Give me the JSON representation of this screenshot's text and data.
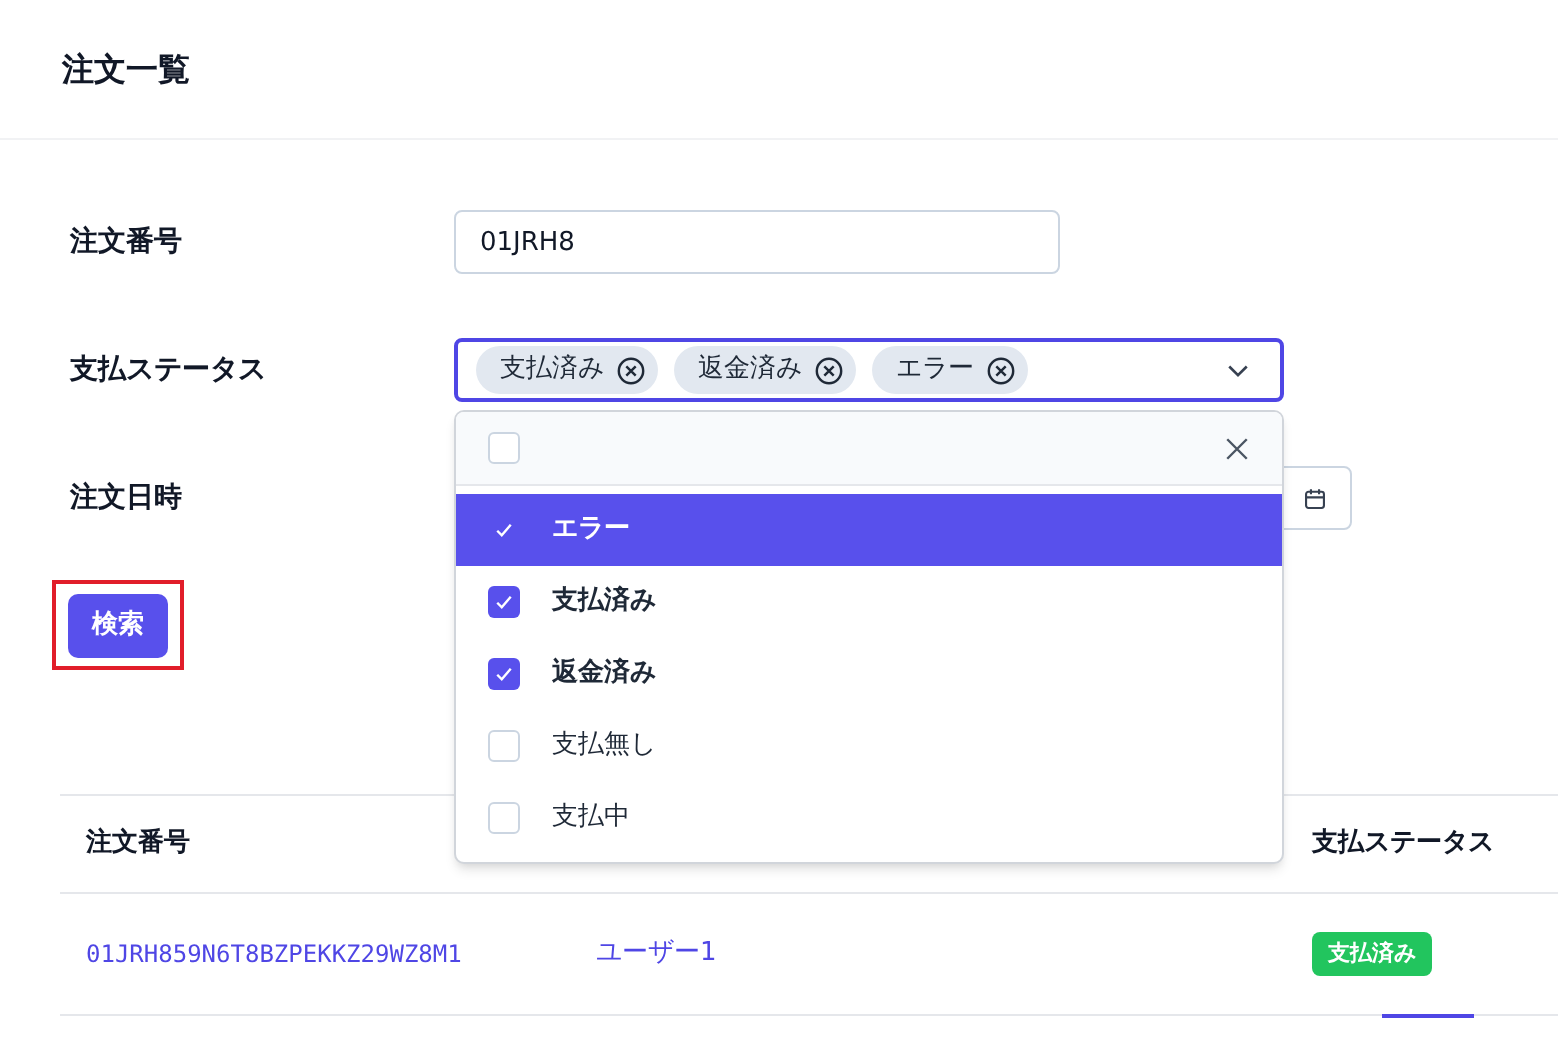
{
  "page": {
    "title": "注文一覧"
  },
  "form": {
    "order_number": {
      "label": "注文番号",
      "value": "01JRH8"
    },
    "payment_status": {
      "label": "支払ステータス",
      "tags": [
        "支払済み",
        "返金済み",
        "エラー"
      ],
      "expanded": true
    },
    "order_date": {
      "label": "注文日時"
    },
    "search_button": {
      "label": "検索",
      "highlighted": true
    }
  },
  "dropdown": {
    "select_all": {
      "checked": false
    },
    "options": [
      {
        "label": "エラー",
        "checked": true,
        "selected": true
      },
      {
        "label": "支払済み",
        "checked": true,
        "selected": false
      },
      {
        "label": "返金済み",
        "checked": true,
        "selected": false
      },
      {
        "label": "支払無し",
        "checked": false,
        "selected": false
      },
      {
        "label": "支払中",
        "checked": false,
        "selected": false
      }
    ]
  },
  "table": {
    "columns": [
      "注文番号",
      "支払ステータス"
    ],
    "rows": [
      {
        "order_number": "01JRH859N6T8BZPEKKZ29WZ8M1",
        "user": "ユーザー1",
        "status": "支払済み"
      }
    ]
  }
}
